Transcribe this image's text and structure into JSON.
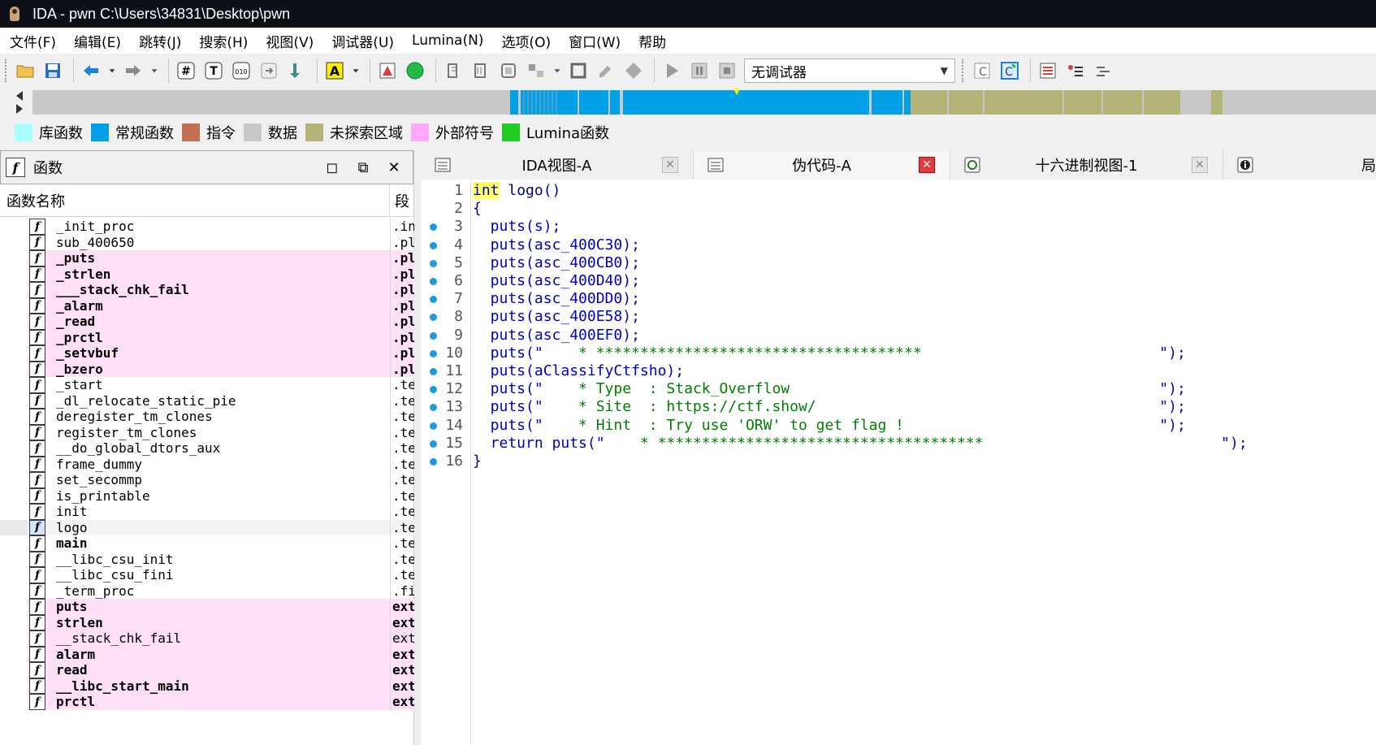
{
  "window": {
    "title": "IDA - pwn C:\\Users\\34831\\Desktop\\pwn"
  },
  "menu": [
    "文件(F)",
    "编辑(E)",
    "跳转(J)",
    "搜索(H)",
    "视图(V)",
    "调试器(U)",
    "Lumina(N)",
    "选项(O)",
    "窗口(W)",
    "帮助"
  ],
  "toolbar": {
    "debugger_select": "无调试器"
  },
  "legend": [
    {
      "label": "库函数",
      "color": "#aaffff"
    },
    {
      "label": "常规函数",
      "color": "#00a0e6"
    },
    {
      "label": "指令",
      "color": "#c07050"
    },
    {
      "label": "数据",
      "color": "#c8c8c8"
    },
    {
      "label": "未探索区域",
      "color": "#b4b478"
    },
    {
      "label": "外部符号",
      "color": "#ffaaff"
    },
    {
      "label": "Lumina函数",
      "color": "#22cc22"
    }
  ],
  "functions_panel": {
    "title": "函数",
    "col_name": "函数名称",
    "col_segment": "段",
    "rows": [
      {
        "name": "_init_proc",
        "seg": ".in",
        "ext": false
      },
      {
        "name": "sub_400650",
        "seg": ".pl",
        "ext": false
      },
      {
        "name": "_puts",
        "seg": ".pl",
        "ext": true
      },
      {
        "name": "_strlen",
        "seg": ".pl",
        "ext": true
      },
      {
        "name": "___stack_chk_fail",
        "seg": ".pl",
        "ext": true
      },
      {
        "name": "_alarm",
        "seg": ".pl",
        "ext": true
      },
      {
        "name": "_read",
        "seg": ".pl",
        "ext": true
      },
      {
        "name": "_prctl",
        "seg": ".pl",
        "ext": true
      },
      {
        "name": "_setvbuf",
        "seg": ".pl",
        "ext": true
      },
      {
        "name": "_bzero",
        "seg": ".pl",
        "ext": true
      },
      {
        "name": "_start",
        "seg": ".te",
        "ext": false
      },
      {
        "name": "_dl_relocate_static_pie",
        "seg": ".te",
        "ext": false
      },
      {
        "name": "deregister_tm_clones",
        "seg": ".te",
        "ext": false
      },
      {
        "name": "register_tm_clones",
        "seg": ".te",
        "ext": false
      },
      {
        "name": "__do_global_dtors_aux",
        "seg": ".te",
        "ext": false
      },
      {
        "name": "frame_dummy",
        "seg": ".te",
        "ext": false
      },
      {
        "name": "set_secommp",
        "seg": ".te",
        "ext": false
      },
      {
        "name": "is_printable",
        "seg": ".te",
        "ext": false
      },
      {
        "name": "init",
        "seg": ".te",
        "ext": false
      },
      {
        "name": "logo",
        "seg": ".te",
        "ext": false,
        "selected": true
      },
      {
        "name": "main",
        "seg": ".te",
        "ext": false,
        "bold": true
      },
      {
        "name": "__libc_csu_init",
        "seg": ".te",
        "ext": false
      },
      {
        "name": "__libc_csu_fini",
        "seg": ".te",
        "ext": false
      },
      {
        "name": "_term_proc",
        "seg": ".fi",
        "ext": false
      },
      {
        "name": "puts",
        "seg": "ext",
        "ext": true
      },
      {
        "name": "strlen",
        "seg": "ext",
        "ext": true
      },
      {
        "name": "__stack_chk_fail",
        "seg": "ext",
        "ext": true,
        "light": true
      },
      {
        "name": "alarm",
        "seg": "ext",
        "ext": true
      },
      {
        "name": "read",
        "seg": "ext",
        "ext": true
      },
      {
        "name": "__libc_start_main",
        "seg": "ext",
        "ext": true
      },
      {
        "name": "prctl",
        "seg": "ext",
        "ext": true
      }
    ]
  },
  "tabs": [
    {
      "label": "IDA视图-A",
      "active": false
    },
    {
      "label": "伪代码-A",
      "active": true
    },
    {
      "label": "十六进制视图-1",
      "active": false
    },
    {
      "label": "局",
      "active": false
    }
  ],
  "code": [
    {
      "n": "1",
      "dot": false,
      "parts": [
        {
          "t": "int",
          "c": "kw"
        },
        {
          "t": " logo()",
          "c": "plain"
        }
      ]
    },
    {
      "n": "2",
      "dot": false,
      "parts": [
        {
          "t": "{",
          "c": "plain"
        }
      ]
    },
    {
      "n": "3",
      "dot": true,
      "parts": [
        {
          "t": "  puts(s);",
          "c": ""
        }
      ]
    },
    {
      "n": "4",
      "dot": true,
      "parts": [
        {
          "t": "  puts(asc_400C30);",
          "c": ""
        }
      ]
    },
    {
      "n": "5",
      "dot": true,
      "parts": [
        {
          "t": "  puts(asc_400CB0);",
          "c": ""
        }
      ]
    },
    {
      "n": "6",
      "dot": true,
      "parts": [
        {
          "t": "  puts(asc_400D40);",
          "c": ""
        }
      ]
    },
    {
      "n": "7",
      "dot": true,
      "parts": [
        {
          "t": "  puts(asc_400DD0);",
          "c": ""
        }
      ]
    },
    {
      "n": "8",
      "dot": true,
      "parts": [
        {
          "t": "  puts(asc_400E58);",
          "c": ""
        }
      ]
    },
    {
      "n": "9",
      "dot": true,
      "parts": [
        {
          "t": "  puts(asc_400EF0);",
          "c": ""
        }
      ]
    },
    {
      "n": "10",
      "dot": true,
      "parts": [
        {
          "t": "  puts(\"",
          "c": ""
        },
        {
          "t": "    * *************************************                           ",
          "c": "str"
        },
        {
          "t": "\");",
          "c": ""
        }
      ]
    },
    {
      "n": "11",
      "dot": true,
      "parts": [
        {
          "t": "  puts(aClassifyCtfsho);",
          "c": ""
        }
      ]
    },
    {
      "n": "12",
      "dot": true,
      "parts": [
        {
          "t": "  puts(\"",
          "c": ""
        },
        {
          "t": "    * Type  : Stack_Overflow                                          ",
          "c": "str"
        },
        {
          "t": "\");",
          "c": ""
        }
      ]
    },
    {
      "n": "13",
      "dot": true,
      "parts": [
        {
          "t": "  puts(\"",
          "c": ""
        },
        {
          "t": "    * Site  : https://ctf.show/                                       ",
          "c": "str"
        },
        {
          "t": "\");",
          "c": ""
        }
      ]
    },
    {
      "n": "14",
      "dot": true,
      "parts": [
        {
          "t": "  puts(\"",
          "c": ""
        },
        {
          "t": "    * Hint  : Try use 'ORW' to get flag !                             ",
          "c": "str"
        },
        {
          "t": "\");",
          "c": ""
        }
      ]
    },
    {
      "n": "15",
      "dot": true,
      "parts": [
        {
          "t": "  return puts(\"",
          "c": ""
        },
        {
          "t": "    * *************************************                           ",
          "c": "str"
        },
        {
          "t": "\");",
          "c": ""
        }
      ]
    },
    {
      "n": "16",
      "dot": true,
      "parts": [
        {
          "t": "}",
          "c": "plain"
        }
      ]
    }
  ]
}
